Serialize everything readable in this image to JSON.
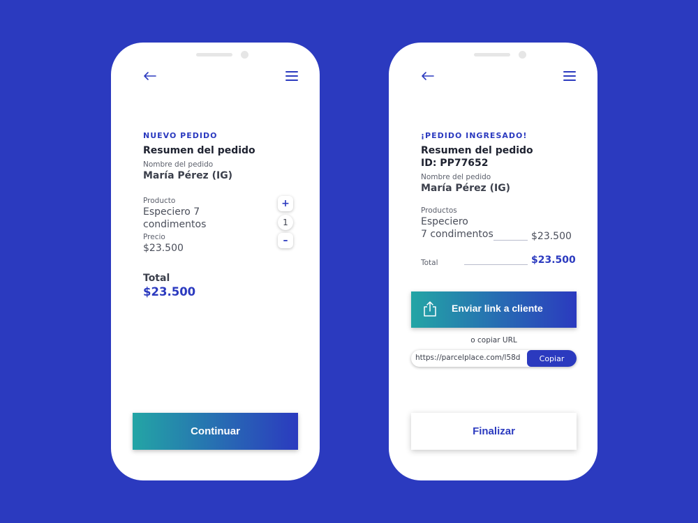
{
  "left": {
    "eyebrow": "NUEVO PEDIDO",
    "title": "Resumen del pedido",
    "order_name_label": "Nombre del pedido",
    "order_name": "María Pérez (IG)",
    "product_label": "Producto",
    "product_line1": "Especiero 7",
    "product_line2": "condimentos",
    "price_label": "Precio",
    "price": "$23.500",
    "quantity": "1",
    "plus": "+",
    "minus": "–",
    "total_label": "Total",
    "total_value": "$23.500",
    "continue_label": "Continuar"
  },
  "right": {
    "eyebrow": "¡PEDIDO INGRESADO!",
    "title": "Resumen del pedido",
    "order_id": "ID: PP77652",
    "order_name_label": "Nombre del pedido",
    "order_name": "María Pérez (IG)",
    "products_label": "Productos",
    "product_line1": "Especiero",
    "product_line2": "7 condimentos",
    "product_price": "$23.500",
    "total_label": "Total",
    "total_value": "$23.500",
    "send_link_label": "Enviar link a cliente",
    "or_copy_label": "o copiar URL",
    "url": "https://parcelplace.com/l58d",
    "copy_label": "Copiar",
    "finish_label": "Finalizar"
  },
  "icons": {
    "back": "arrow-left-icon",
    "menu": "hamburger-menu-icon",
    "share": "share-upload-icon"
  },
  "colors": {
    "background": "#2b3abf",
    "accent": "#2b3abf",
    "gradient_start": "#23a5a5",
    "gradient_end": "#2b3abf"
  }
}
